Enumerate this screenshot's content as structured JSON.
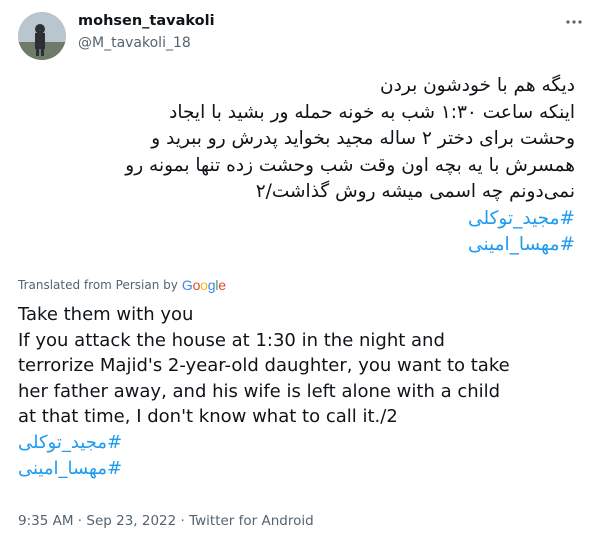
{
  "author": {
    "display_name": "mohsen_tavakoli",
    "handle": "@M_tavakoli_18"
  },
  "icons": {
    "more": "more-horizontal-icon",
    "avatar": "user-avatar"
  },
  "tweet": {
    "lines": [
      "دیگه هم با خودشون بردن",
      "اینکه ساعت ۱:۳۰ شب به خونه حمله ور بشید با ایجاد",
      "وحشت برای دختر ۲ ساله مجید بخواید پدرش رو ببرید و",
      "همسرش با یه بچه اون وقت شب وحشت زده تنها بمونه رو",
      "نمی‌دونم چه اسمی میشه روش گذاشت/۲"
    ],
    "hashtags": [
      "#مجید_توکلی",
      "#مهسا_امینی"
    ]
  },
  "translation": {
    "label": "Translated from Persian by",
    "provider": "Google",
    "lines": [
      "Take them with you",
      "If you attack the house at 1:30 in the night and",
      "terrorize Majid's 2-year-old daughter, you want to take",
      "her father away, and his wife is left alone with a child",
      "at that time, I don't know what to call it./2"
    ],
    "hashtags": [
      "#مجید_توکلی",
      "#مهسا_امینی"
    ]
  },
  "meta": {
    "time": "9:35 AM",
    "separator": " · ",
    "date": "Sep 23, 2022",
    "source": "Twitter for Android"
  },
  "colors": {
    "link": "#1d9bf0",
    "secondary_text": "#536471",
    "primary_text": "#0f1419"
  }
}
